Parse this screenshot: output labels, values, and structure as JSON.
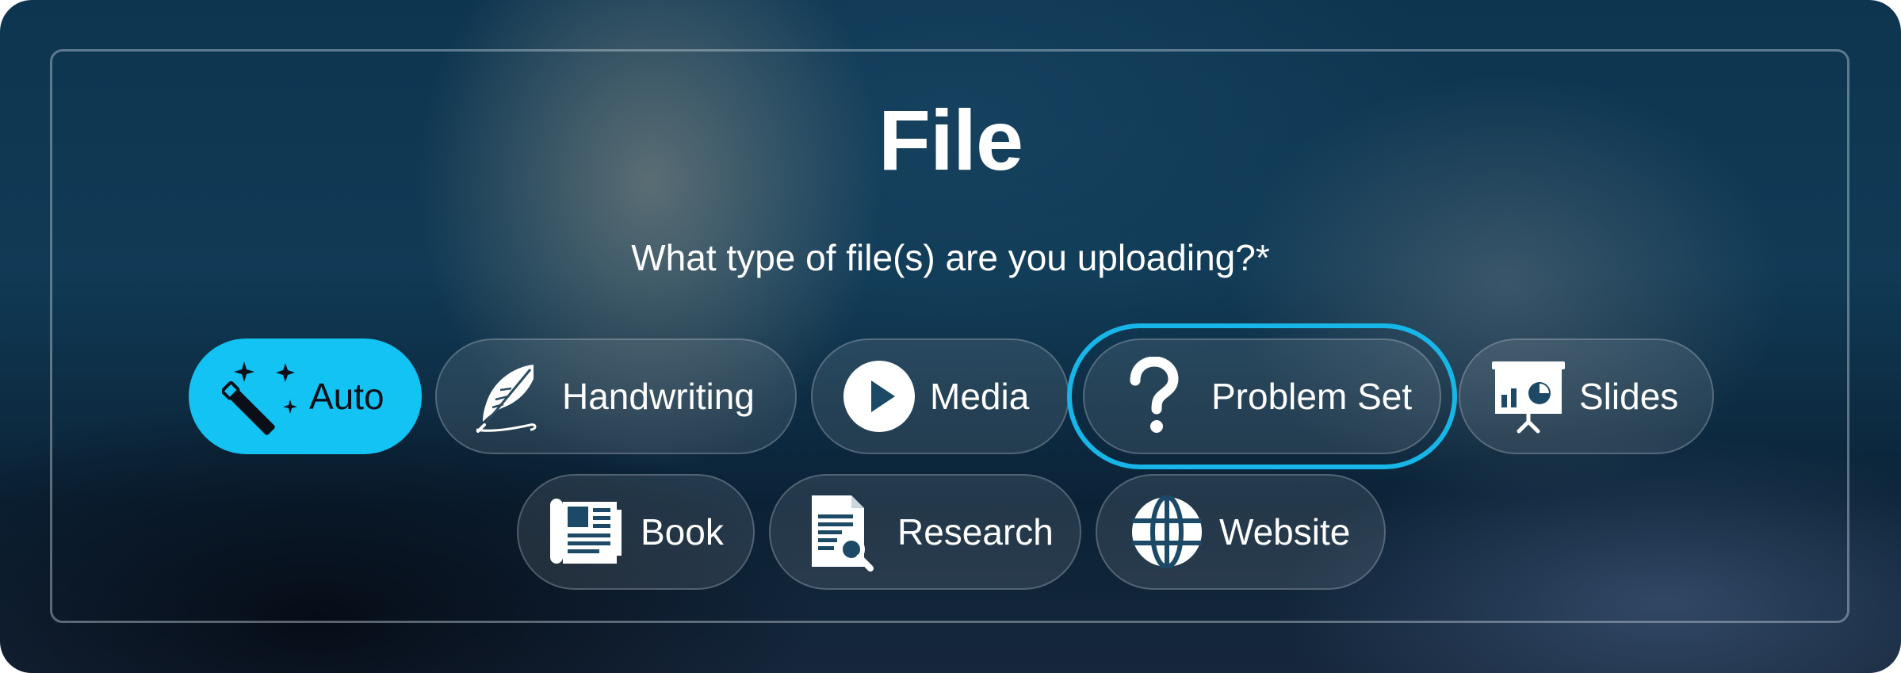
{
  "dialog": {
    "title": "File",
    "question": "What type of file(s) are you uploading?*"
  },
  "file_types": [
    {
      "label": "Auto",
      "icon": "magic-wand-icon",
      "selected": true
    },
    {
      "label": "Handwriting",
      "icon": "quill-feather-icon",
      "selected": false
    },
    {
      "label": "Media",
      "icon": "play-circle-icon",
      "selected": false
    },
    {
      "label": "Problem Set",
      "icon": "question-mark-icon",
      "selected": false,
      "focused": true
    },
    {
      "label": "Slides",
      "icon": "presentation-chart-icon",
      "selected": false
    },
    {
      "label": "Book",
      "icon": "book-icon",
      "selected": false
    },
    {
      "label": "Research",
      "icon": "document-search-icon",
      "selected": false
    },
    {
      "label": "Website",
      "icon": "globe-icon",
      "selected": false
    }
  ],
  "colors": {
    "accent": "#12c3f3",
    "focus_ring": "#17b6e8",
    "text": "#ffffff"
  }
}
